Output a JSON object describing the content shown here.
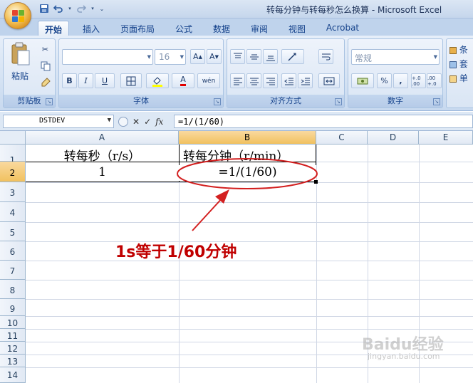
{
  "window": {
    "title": "转每分钟与转每秒怎么换算 - Microsoft Excel"
  },
  "ribbon_tabs": [
    "开始",
    "插入",
    "页面布局",
    "公式",
    "数据",
    "审阅",
    "视图",
    "Acrobat"
  ],
  "ribbon": {
    "clipboard": {
      "label": "剪贴板",
      "paste_label": "粘贴"
    },
    "font": {
      "label": "字体",
      "font_name": "",
      "font_size": "16",
      "bold": "B",
      "italic": "I",
      "underline": "U",
      "font_color_glyph": "A",
      "phonetic_glyph": "wén"
    },
    "alignment": {
      "label": "对齐方式"
    },
    "number": {
      "label": "数字",
      "format": "常规",
      "percent": "%",
      "comma": ",",
      "inc_decimal": "+.0 .00",
      "dec_decimal": ".00 +.0"
    },
    "styles": {
      "item1": "条",
      "item2": "套",
      "item3": "单"
    }
  },
  "formula_bar": {
    "name_box": "DSTDEV",
    "cancel_glyph": "✕",
    "enter_glyph": "✓",
    "fx_label": "fx",
    "formula": "=1/(1/60)"
  },
  "columns": [
    "A",
    "B",
    "C",
    "D",
    "E"
  ],
  "rows": [
    "1",
    "2",
    "3",
    "4",
    "5",
    "6",
    "7",
    "8",
    "9",
    "10",
    "11",
    "12",
    "13",
    "14"
  ],
  "cells": {
    "A1": "转每秒（r/s）",
    "B1": "转每分钟（r/min）",
    "A2": "1",
    "B2": "=1/(1/60)"
  },
  "annotation": {
    "text": "1s等于1/60分钟",
    "color": "#c00000"
  },
  "watermark": {
    "text": "Baidu经验",
    "sub": "jingyan.baidu.com"
  }
}
